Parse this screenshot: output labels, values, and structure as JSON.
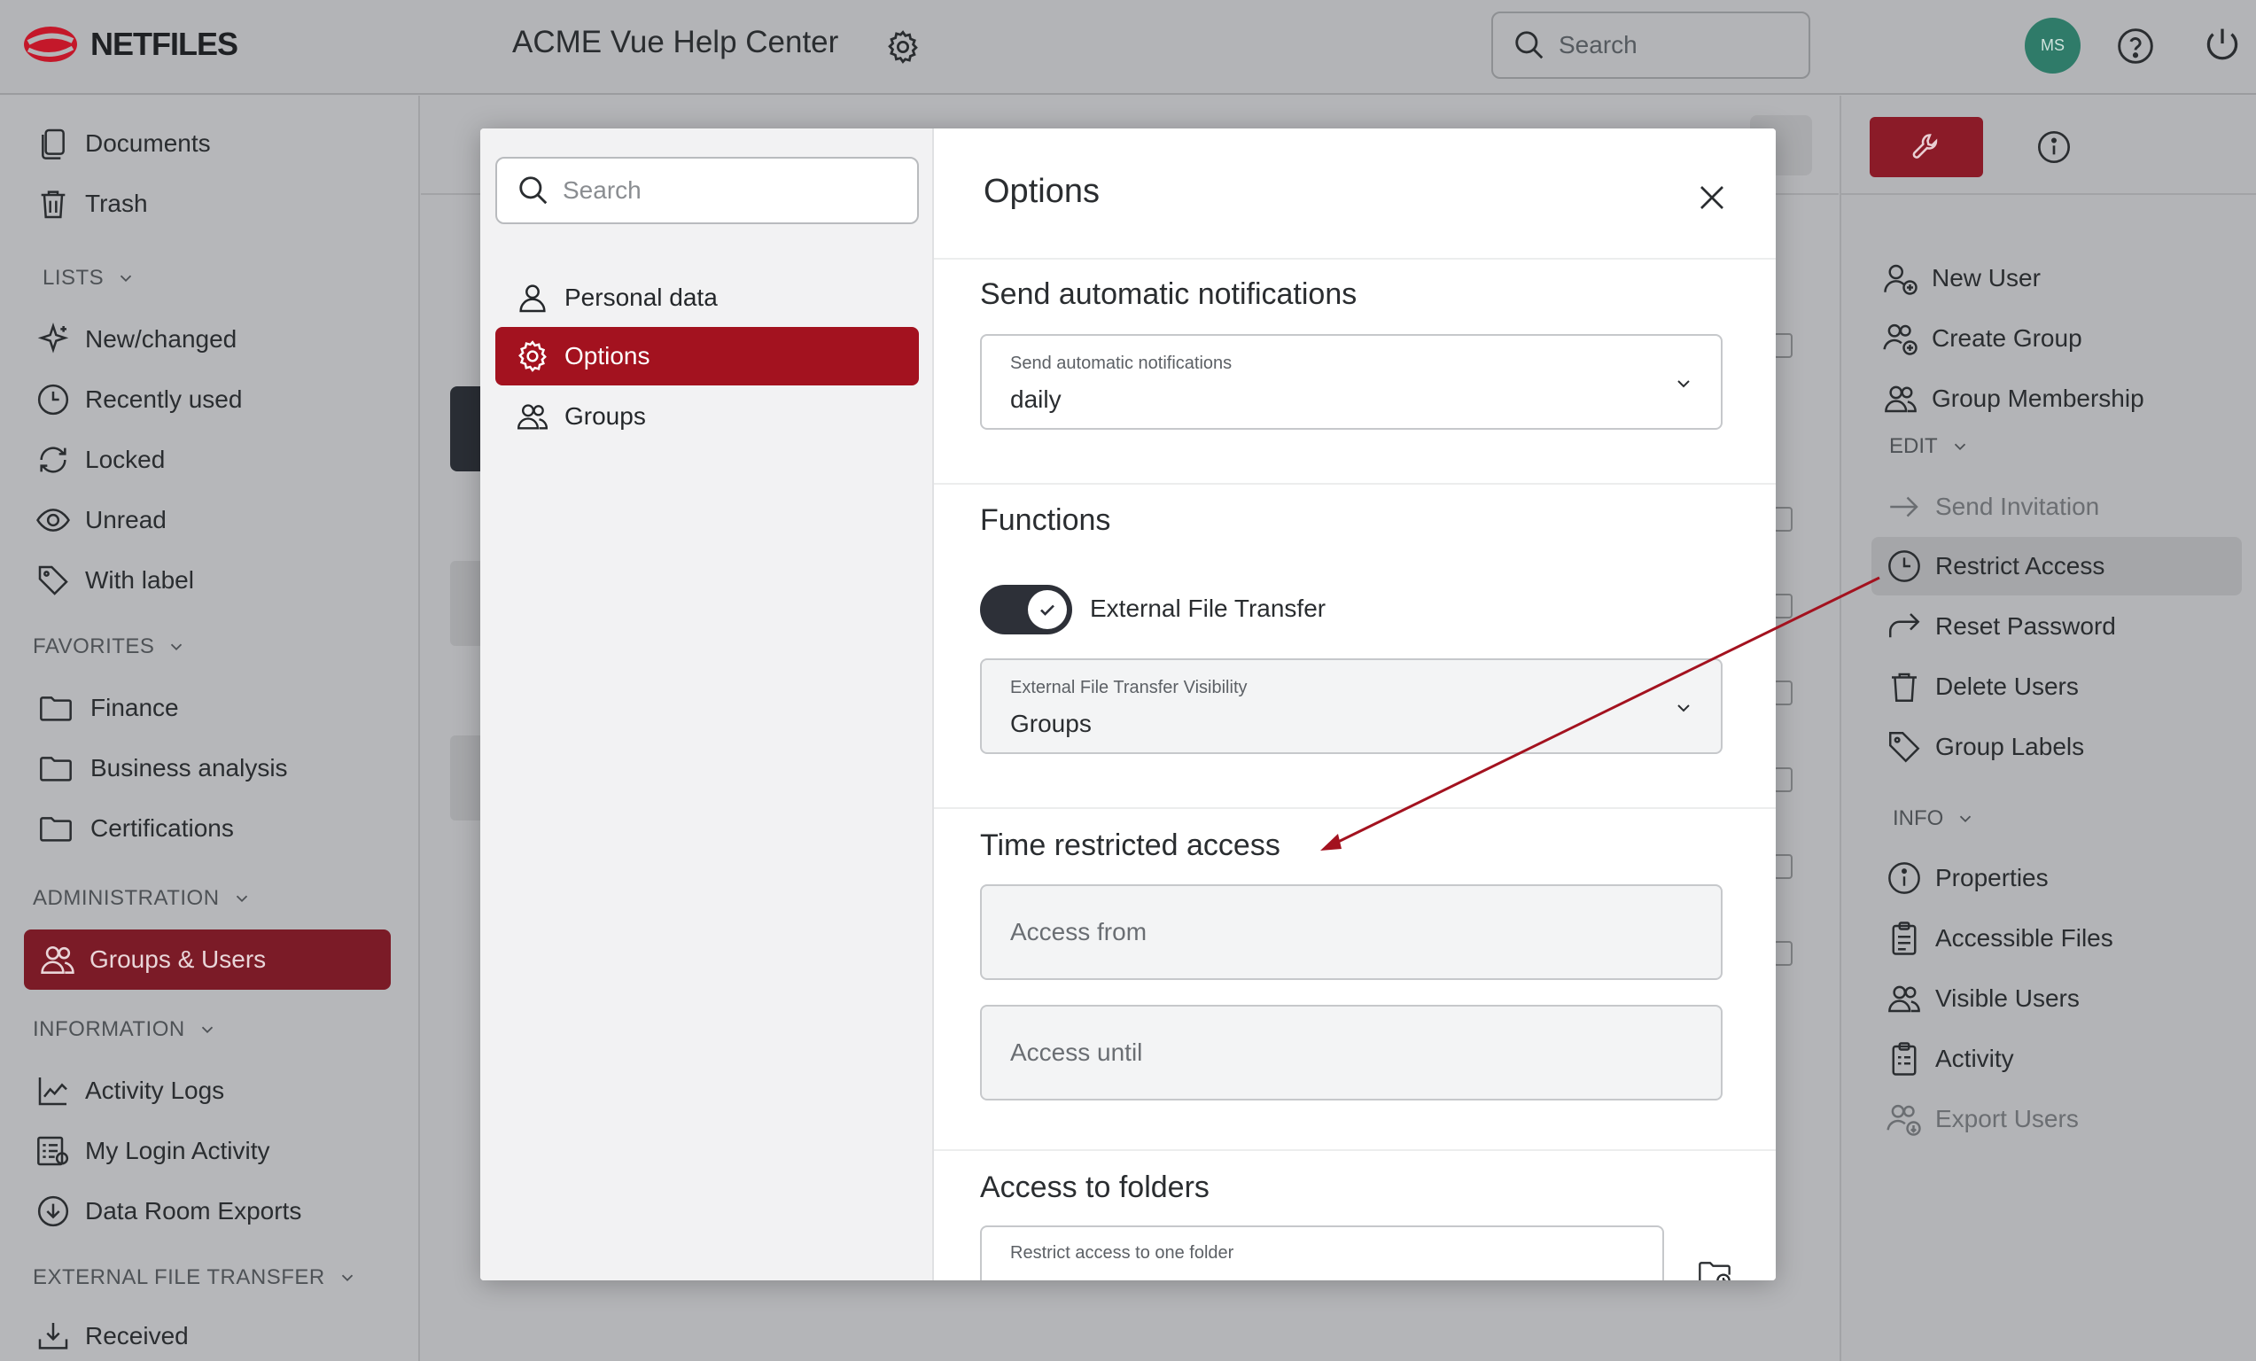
{
  "header": {
    "logo_text": "NETFILES",
    "app_title": "ACME Vue Help Center",
    "search_placeholder": "Search",
    "avatar_initials": "MS"
  },
  "left_sidebar": {
    "items_top": [
      {
        "label": "Documents",
        "icon": "documents-icon"
      },
      {
        "label": "Trash",
        "icon": "trash-icon"
      }
    ],
    "lists_title": "LISTS",
    "lists": [
      {
        "label": "New/changed",
        "icon": "sparkle-icon"
      },
      {
        "label": "Recently used",
        "icon": "clock-icon"
      },
      {
        "label": "Locked",
        "icon": "refresh-icon"
      },
      {
        "label": "Unread",
        "icon": "eye-icon"
      },
      {
        "label": "With label",
        "icon": "tag-icon"
      }
    ],
    "favorites_title": "FAVORITES",
    "favorites": [
      {
        "label": "Finance",
        "icon": "folder-icon"
      },
      {
        "label": "Business analysis",
        "icon": "folder-icon"
      },
      {
        "label": "Certifications",
        "icon": "folder-icon"
      }
    ],
    "administration_title": "ADMINISTRATION",
    "administration_active": "Groups & Users",
    "information_title": "INFORMATION",
    "information": [
      {
        "label": "Activity Logs",
        "icon": "chart-icon"
      },
      {
        "label": "My Login Activity",
        "icon": "list-icon"
      },
      {
        "label": "Data Room Exports",
        "icon": "download-circle-icon"
      }
    ],
    "eft_title": "EXTERNAL FILE TRANSFER",
    "eft": [
      {
        "label": "Received",
        "icon": "inbox-download-icon"
      }
    ]
  },
  "right_sidebar": {
    "actions": [
      {
        "label": "New User",
        "icon": "user-plus-icon"
      },
      {
        "label": "Create Group",
        "icon": "group-plus-icon"
      },
      {
        "label": "Group Membership",
        "icon": "group-icon"
      }
    ],
    "edit_title": "EDIT",
    "edit": [
      {
        "label": "Send Invitation",
        "icon": "arrow-right-icon",
        "disabled": true
      },
      {
        "label": "Restrict Access",
        "icon": "clock-icon",
        "highlighted": true
      },
      {
        "label": "Reset Password",
        "icon": "forward-icon"
      },
      {
        "label": "Delete Users",
        "icon": "trash-icon"
      },
      {
        "label": "Group Labels",
        "icon": "tag-icon"
      }
    ],
    "info_title": "INFO",
    "info": [
      {
        "label": "Properties",
        "icon": "info-icon"
      },
      {
        "label": "Accessible Files",
        "icon": "clipboard-icon"
      },
      {
        "label": "Visible Users",
        "icon": "group-icon"
      },
      {
        "label": "Activity",
        "icon": "clipboard-list-icon"
      },
      {
        "label": "Export Users",
        "icon": "group-export-icon",
        "disabled": true
      }
    ]
  },
  "modal": {
    "search_placeholder": "Search",
    "nav": [
      {
        "label": "Personal data",
        "icon": "user-icon",
        "active": false
      },
      {
        "label": "Options",
        "icon": "gear-icon",
        "active": true
      },
      {
        "label": "Groups",
        "icon": "group-icon",
        "active": false
      }
    ],
    "title": "Options",
    "notifications": {
      "section_title": "Send automatic notifications",
      "field_label": "Send automatic notifications",
      "value": "daily"
    },
    "functions": {
      "section_title": "Functions",
      "toggle_label": "External File Transfer",
      "toggle_on": true,
      "visibility_label": "External File Transfer Visibility",
      "visibility_value": "Groups"
    },
    "time_restricted": {
      "section_title": "Time restricted access",
      "from_placeholder": "Access from",
      "until_placeholder": "Access until"
    },
    "folders": {
      "section_title": "Access to folders",
      "field_label": "Restrict access to one folder"
    }
  },
  "colors": {
    "brand_red": "#a3121f",
    "active_sidebar": "#7b1b27",
    "arrow": "#a3121f",
    "avatar": "#2f7b69"
  }
}
